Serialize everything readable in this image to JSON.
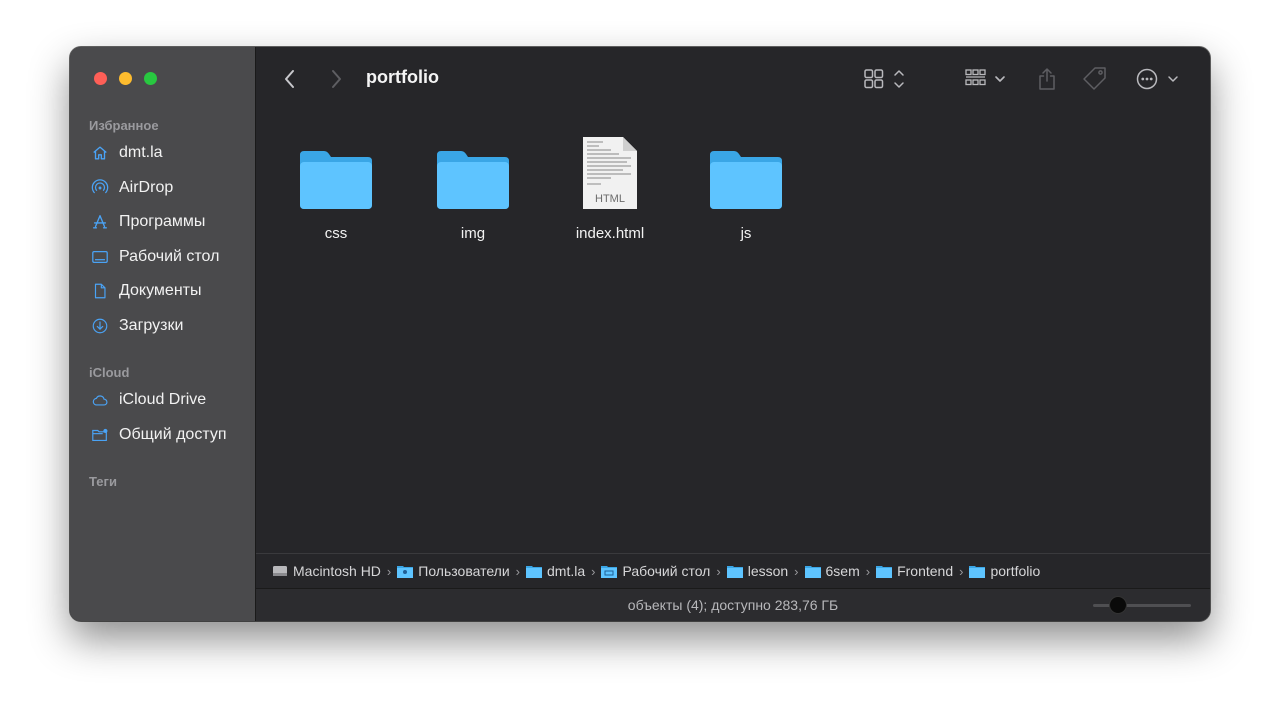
{
  "window": {
    "title": "portfolio"
  },
  "sidebar": {
    "favorites_header": "Избранное",
    "favorites": [
      {
        "label": "dmt.la",
        "icon": "house-icon"
      },
      {
        "label": "AirDrop",
        "icon": "airdrop-icon"
      },
      {
        "label": "Программы",
        "icon": "applications-icon"
      },
      {
        "label": "Рабочий стол",
        "icon": "desktop-icon"
      },
      {
        "label": "Документы",
        "icon": "document-icon"
      },
      {
        "label": "Загрузки",
        "icon": "download-icon"
      }
    ],
    "icloud_header": "iCloud",
    "icloud": [
      {
        "label": "iCloud Drive",
        "icon": "cloud-icon"
      },
      {
        "label": "Общий доступ",
        "icon": "shared-folder-icon"
      }
    ],
    "tags_header": "Теги"
  },
  "files": [
    {
      "name": "css",
      "kind": "folder"
    },
    {
      "name": "img",
      "kind": "folder"
    },
    {
      "name": "index.html",
      "kind": "html",
      "badge": "HTML"
    },
    {
      "name": "js",
      "kind": "folder"
    }
  ],
  "path": [
    {
      "label": "Macintosh HD",
      "icon": "disk-icon"
    },
    {
      "label": "Пользователи",
      "icon": "users-folder-icon"
    },
    {
      "label": "dmt.la",
      "icon": "folder-icon"
    },
    {
      "label": "Рабочий стол",
      "icon": "desktop-folder-icon"
    },
    {
      "label": "lesson",
      "icon": "folder-icon"
    },
    {
      "label": "6sem",
      "icon": "folder-icon"
    },
    {
      "label": "Frontend",
      "icon": "folder-icon"
    },
    {
      "label": "portfolio",
      "icon": "folder-icon"
    }
  ],
  "path_separator": "›",
  "status": {
    "text": "объекты (4); доступно 283,76 ГБ",
    "zoom_level": 0.25
  },
  "colors": {
    "accent": "#4aa3f5",
    "folder": "#5ec4ff",
    "sidebar": "#4a4a4c",
    "content": "#262629"
  }
}
